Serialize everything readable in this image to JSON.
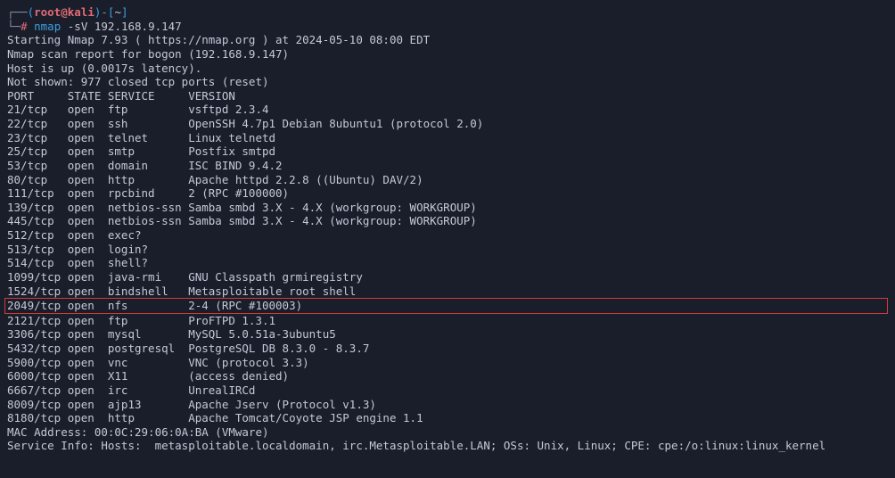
{
  "prompt": {
    "user": "root",
    "at": "@",
    "host": "kali",
    "path": "~",
    "hash": "#",
    "cmd": "nmap",
    "args": "-sV 192.168.9.147"
  },
  "intro": {
    "l1": "Starting Nmap 7.93 ( https://nmap.org ) at 2024-05-10 08:00 EDT",
    "l2": "Nmap scan report for bogon (192.168.9.147)",
    "l3": "Host is up (0.0017s latency).",
    "l4": "Not shown: 977 closed tcp ports (reset)",
    "header": "PORT     STATE SERVICE     VERSION"
  },
  "rows": {
    "r0": "21/tcp   open  ftp         vsftpd 2.3.4",
    "r1": "22/tcp   open  ssh         OpenSSH 4.7p1 Debian 8ubuntu1 (protocol 2.0)",
    "r2": "23/tcp   open  telnet      Linux telnetd",
    "r3": "25/tcp   open  smtp        Postfix smtpd",
    "r4": "53/tcp   open  domain      ISC BIND 9.4.2",
    "r5": "80/tcp   open  http        Apache httpd 2.2.8 ((Ubuntu) DAV/2)",
    "r6": "111/tcp  open  rpcbind     2 (RPC #100000)",
    "r7": "139/tcp  open  netbios-ssn Samba smbd 3.X - 4.X (workgroup: WORKGROUP)",
    "r8": "445/tcp  open  netbios-ssn Samba smbd 3.X - 4.X (workgroup: WORKGROUP)",
    "r9": "512/tcp  open  exec?",
    "r10": "513/tcp  open  login?",
    "r11": "514/tcp  open  shell?",
    "r12": "1099/tcp open  java-rmi    GNU Classpath grmiregistry",
    "r13": "1524/tcp open  bindshell   Metasploitable root shell",
    "r14": "2049/tcp open  nfs         2-4 (RPC #100003)",
    "r15": "2121/tcp open  ftp         ProFTPD 1.3.1",
    "r16": "3306/tcp open  mysql       MySQL 5.0.51a-3ubuntu5",
    "r17": "5432/tcp open  postgresql  PostgreSQL DB 8.3.0 - 8.3.7",
    "r18": "5900/tcp open  vnc         VNC (protocol 3.3)",
    "r19": "6000/tcp open  X11         (access denied)",
    "r20": "6667/tcp open  irc         UnrealIRCd",
    "r21": "8009/tcp open  ajp13       Apache Jserv (Protocol v1.3)",
    "r22": "8180/tcp open  http        Apache Tomcat/Coyote JSP engine 1.1"
  },
  "footer": {
    "mac": "MAC Address: 00:0C:29:06:0A:BA (VMware)",
    "svc": "Service Info: Hosts:  metasploitable.localdomain, irc.Metasploitable.LAN; OSs: Unix, Linux; CPE: cpe:/o:linux:linux_kernel"
  }
}
